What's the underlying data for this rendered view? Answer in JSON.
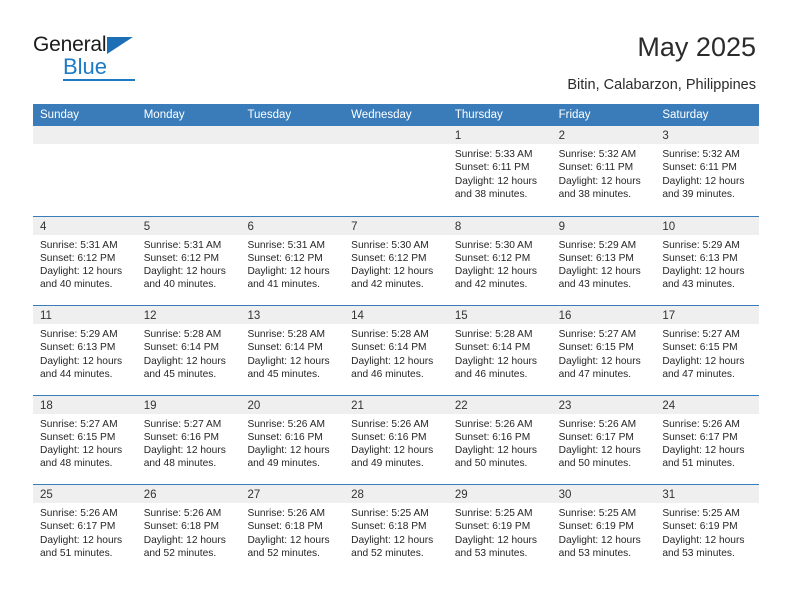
{
  "brand": {
    "name_primary": "General",
    "name_secondary": "Blue"
  },
  "header": {
    "title": "May 2025",
    "location": "Bitin, Calabarzon, Philippines"
  },
  "colors": {
    "header_blue": "#3a7cba",
    "band_gray": "#efefef",
    "logo_blue": "#1d7ac4",
    "text": "#262626"
  },
  "weekdays": [
    "Sunday",
    "Monday",
    "Tuesday",
    "Wednesday",
    "Thursday",
    "Friday",
    "Saturday"
  ],
  "weeks": [
    [
      {
        "date": "",
        "sunrise": "",
        "sunset": "",
        "daylight": "",
        "empty": true
      },
      {
        "date": "",
        "sunrise": "",
        "sunset": "",
        "daylight": "",
        "empty": true
      },
      {
        "date": "",
        "sunrise": "",
        "sunset": "",
        "daylight": "",
        "empty": true
      },
      {
        "date": "",
        "sunrise": "",
        "sunset": "",
        "daylight": "",
        "empty": true
      },
      {
        "date": "1",
        "sunrise": "Sunrise: 5:33 AM",
        "sunset": "Sunset: 6:11 PM",
        "daylight": "Daylight: 12 hours and 38 minutes."
      },
      {
        "date": "2",
        "sunrise": "Sunrise: 5:32 AM",
        "sunset": "Sunset: 6:11 PM",
        "daylight": "Daylight: 12 hours and 38 minutes."
      },
      {
        "date": "3",
        "sunrise": "Sunrise: 5:32 AM",
        "sunset": "Sunset: 6:11 PM",
        "daylight": "Daylight: 12 hours and 39 minutes."
      }
    ],
    [
      {
        "date": "4",
        "sunrise": "Sunrise: 5:31 AM",
        "sunset": "Sunset: 6:12 PM",
        "daylight": "Daylight: 12 hours and 40 minutes."
      },
      {
        "date": "5",
        "sunrise": "Sunrise: 5:31 AM",
        "sunset": "Sunset: 6:12 PM",
        "daylight": "Daylight: 12 hours and 40 minutes."
      },
      {
        "date": "6",
        "sunrise": "Sunrise: 5:31 AM",
        "sunset": "Sunset: 6:12 PM",
        "daylight": "Daylight: 12 hours and 41 minutes."
      },
      {
        "date": "7",
        "sunrise": "Sunrise: 5:30 AM",
        "sunset": "Sunset: 6:12 PM",
        "daylight": "Daylight: 12 hours and 42 minutes."
      },
      {
        "date": "8",
        "sunrise": "Sunrise: 5:30 AM",
        "sunset": "Sunset: 6:12 PM",
        "daylight": "Daylight: 12 hours and 42 minutes."
      },
      {
        "date": "9",
        "sunrise": "Sunrise: 5:29 AM",
        "sunset": "Sunset: 6:13 PM",
        "daylight": "Daylight: 12 hours and 43 minutes."
      },
      {
        "date": "10",
        "sunrise": "Sunrise: 5:29 AM",
        "sunset": "Sunset: 6:13 PM",
        "daylight": "Daylight: 12 hours and 43 minutes."
      }
    ],
    [
      {
        "date": "11",
        "sunrise": "Sunrise: 5:29 AM",
        "sunset": "Sunset: 6:13 PM",
        "daylight": "Daylight: 12 hours and 44 minutes."
      },
      {
        "date": "12",
        "sunrise": "Sunrise: 5:28 AM",
        "sunset": "Sunset: 6:14 PM",
        "daylight": "Daylight: 12 hours and 45 minutes."
      },
      {
        "date": "13",
        "sunrise": "Sunrise: 5:28 AM",
        "sunset": "Sunset: 6:14 PM",
        "daylight": "Daylight: 12 hours and 45 minutes."
      },
      {
        "date": "14",
        "sunrise": "Sunrise: 5:28 AM",
        "sunset": "Sunset: 6:14 PM",
        "daylight": "Daylight: 12 hours and 46 minutes."
      },
      {
        "date": "15",
        "sunrise": "Sunrise: 5:28 AM",
        "sunset": "Sunset: 6:14 PM",
        "daylight": "Daylight: 12 hours and 46 minutes."
      },
      {
        "date": "16",
        "sunrise": "Sunrise: 5:27 AM",
        "sunset": "Sunset: 6:15 PM",
        "daylight": "Daylight: 12 hours and 47 minutes."
      },
      {
        "date": "17",
        "sunrise": "Sunrise: 5:27 AM",
        "sunset": "Sunset: 6:15 PM",
        "daylight": "Daylight: 12 hours and 47 minutes."
      }
    ],
    [
      {
        "date": "18",
        "sunrise": "Sunrise: 5:27 AM",
        "sunset": "Sunset: 6:15 PM",
        "daylight": "Daylight: 12 hours and 48 minutes."
      },
      {
        "date": "19",
        "sunrise": "Sunrise: 5:27 AM",
        "sunset": "Sunset: 6:16 PM",
        "daylight": "Daylight: 12 hours and 48 minutes."
      },
      {
        "date": "20",
        "sunrise": "Sunrise: 5:26 AM",
        "sunset": "Sunset: 6:16 PM",
        "daylight": "Daylight: 12 hours and 49 minutes."
      },
      {
        "date": "21",
        "sunrise": "Sunrise: 5:26 AM",
        "sunset": "Sunset: 6:16 PM",
        "daylight": "Daylight: 12 hours and 49 minutes."
      },
      {
        "date": "22",
        "sunrise": "Sunrise: 5:26 AM",
        "sunset": "Sunset: 6:16 PM",
        "daylight": "Daylight: 12 hours and 50 minutes."
      },
      {
        "date": "23",
        "sunrise": "Sunrise: 5:26 AM",
        "sunset": "Sunset: 6:17 PM",
        "daylight": "Daylight: 12 hours and 50 minutes."
      },
      {
        "date": "24",
        "sunrise": "Sunrise: 5:26 AM",
        "sunset": "Sunset: 6:17 PM",
        "daylight": "Daylight: 12 hours and 51 minutes."
      }
    ],
    [
      {
        "date": "25",
        "sunrise": "Sunrise: 5:26 AM",
        "sunset": "Sunset: 6:17 PM",
        "daylight": "Daylight: 12 hours and 51 minutes."
      },
      {
        "date": "26",
        "sunrise": "Sunrise: 5:26 AM",
        "sunset": "Sunset: 6:18 PM",
        "daylight": "Daylight: 12 hours and 52 minutes."
      },
      {
        "date": "27",
        "sunrise": "Sunrise: 5:26 AM",
        "sunset": "Sunset: 6:18 PM",
        "daylight": "Daylight: 12 hours and 52 minutes."
      },
      {
        "date": "28",
        "sunrise": "Sunrise: 5:25 AM",
        "sunset": "Sunset: 6:18 PM",
        "daylight": "Daylight: 12 hours and 52 minutes."
      },
      {
        "date": "29",
        "sunrise": "Sunrise: 5:25 AM",
        "sunset": "Sunset: 6:19 PM",
        "daylight": "Daylight: 12 hours and 53 minutes."
      },
      {
        "date": "30",
        "sunrise": "Sunrise: 5:25 AM",
        "sunset": "Sunset: 6:19 PM",
        "daylight": "Daylight: 12 hours and 53 minutes."
      },
      {
        "date": "31",
        "sunrise": "Sunrise: 5:25 AM",
        "sunset": "Sunset: 6:19 PM",
        "daylight": "Daylight: 12 hours and 53 minutes."
      }
    ]
  ]
}
